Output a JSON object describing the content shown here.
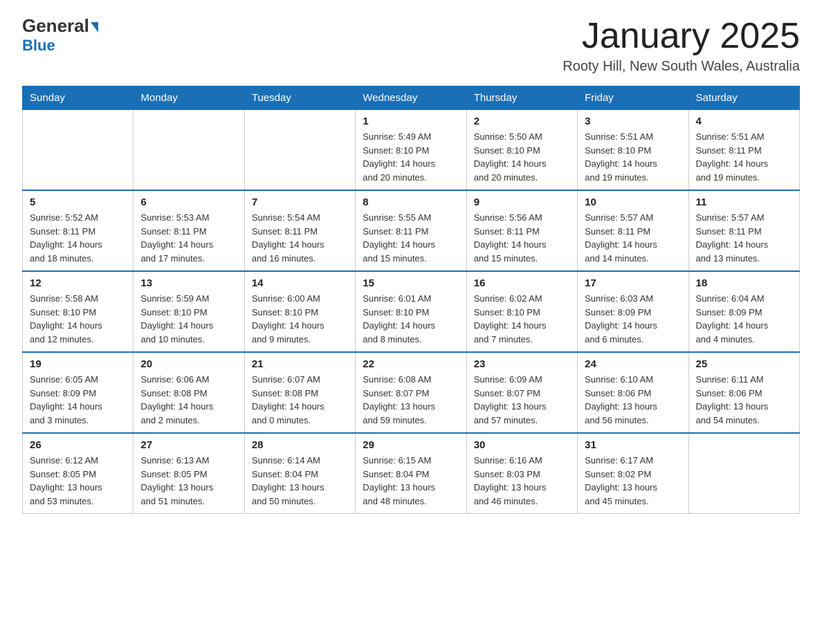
{
  "logo": {
    "general": "General",
    "arrow": "▶",
    "blue": "Blue"
  },
  "title": "January 2025",
  "subtitle": "Rooty Hill, New South Wales, Australia",
  "days_header": [
    "Sunday",
    "Monday",
    "Tuesday",
    "Wednesday",
    "Thursday",
    "Friday",
    "Saturday"
  ],
  "weeks": [
    [
      {
        "num": "",
        "info": ""
      },
      {
        "num": "",
        "info": ""
      },
      {
        "num": "",
        "info": ""
      },
      {
        "num": "1",
        "info": "Sunrise: 5:49 AM\nSunset: 8:10 PM\nDaylight: 14 hours\nand 20 minutes."
      },
      {
        "num": "2",
        "info": "Sunrise: 5:50 AM\nSunset: 8:10 PM\nDaylight: 14 hours\nand 20 minutes."
      },
      {
        "num": "3",
        "info": "Sunrise: 5:51 AM\nSunset: 8:10 PM\nDaylight: 14 hours\nand 19 minutes."
      },
      {
        "num": "4",
        "info": "Sunrise: 5:51 AM\nSunset: 8:11 PM\nDaylight: 14 hours\nand 19 minutes."
      }
    ],
    [
      {
        "num": "5",
        "info": "Sunrise: 5:52 AM\nSunset: 8:11 PM\nDaylight: 14 hours\nand 18 minutes."
      },
      {
        "num": "6",
        "info": "Sunrise: 5:53 AM\nSunset: 8:11 PM\nDaylight: 14 hours\nand 17 minutes."
      },
      {
        "num": "7",
        "info": "Sunrise: 5:54 AM\nSunset: 8:11 PM\nDaylight: 14 hours\nand 16 minutes."
      },
      {
        "num": "8",
        "info": "Sunrise: 5:55 AM\nSunset: 8:11 PM\nDaylight: 14 hours\nand 15 minutes."
      },
      {
        "num": "9",
        "info": "Sunrise: 5:56 AM\nSunset: 8:11 PM\nDaylight: 14 hours\nand 15 minutes."
      },
      {
        "num": "10",
        "info": "Sunrise: 5:57 AM\nSunset: 8:11 PM\nDaylight: 14 hours\nand 14 minutes."
      },
      {
        "num": "11",
        "info": "Sunrise: 5:57 AM\nSunset: 8:11 PM\nDaylight: 14 hours\nand 13 minutes."
      }
    ],
    [
      {
        "num": "12",
        "info": "Sunrise: 5:58 AM\nSunset: 8:10 PM\nDaylight: 14 hours\nand 12 minutes."
      },
      {
        "num": "13",
        "info": "Sunrise: 5:59 AM\nSunset: 8:10 PM\nDaylight: 14 hours\nand 10 minutes."
      },
      {
        "num": "14",
        "info": "Sunrise: 6:00 AM\nSunset: 8:10 PM\nDaylight: 14 hours\nand 9 minutes."
      },
      {
        "num": "15",
        "info": "Sunrise: 6:01 AM\nSunset: 8:10 PM\nDaylight: 14 hours\nand 8 minutes."
      },
      {
        "num": "16",
        "info": "Sunrise: 6:02 AM\nSunset: 8:10 PM\nDaylight: 14 hours\nand 7 minutes."
      },
      {
        "num": "17",
        "info": "Sunrise: 6:03 AM\nSunset: 8:09 PM\nDaylight: 14 hours\nand 6 minutes."
      },
      {
        "num": "18",
        "info": "Sunrise: 6:04 AM\nSunset: 8:09 PM\nDaylight: 14 hours\nand 4 minutes."
      }
    ],
    [
      {
        "num": "19",
        "info": "Sunrise: 6:05 AM\nSunset: 8:09 PM\nDaylight: 14 hours\nand 3 minutes."
      },
      {
        "num": "20",
        "info": "Sunrise: 6:06 AM\nSunset: 8:08 PM\nDaylight: 14 hours\nand 2 minutes."
      },
      {
        "num": "21",
        "info": "Sunrise: 6:07 AM\nSunset: 8:08 PM\nDaylight: 14 hours\nand 0 minutes."
      },
      {
        "num": "22",
        "info": "Sunrise: 6:08 AM\nSunset: 8:07 PM\nDaylight: 13 hours\nand 59 minutes."
      },
      {
        "num": "23",
        "info": "Sunrise: 6:09 AM\nSunset: 8:07 PM\nDaylight: 13 hours\nand 57 minutes."
      },
      {
        "num": "24",
        "info": "Sunrise: 6:10 AM\nSunset: 8:06 PM\nDaylight: 13 hours\nand 56 minutes."
      },
      {
        "num": "25",
        "info": "Sunrise: 6:11 AM\nSunset: 8:06 PM\nDaylight: 13 hours\nand 54 minutes."
      }
    ],
    [
      {
        "num": "26",
        "info": "Sunrise: 6:12 AM\nSunset: 8:05 PM\nDaylight: 13 hours\nand 53 minutes."
      },
      {
        "num": "27",
        "info": "Sunrise: 6:13 AM\nSunset: 8:05 PM\nDaylight: 13 hours\nand 51 minutes."
      },
      {
        "num": "28",
        "info": "Sunrise: 6:14 AM\nSunset: 8:04 PM\nDaylight: 13 hours\nand 50 minutes."
      },
      {
        "num": "29",
        "info": "Sunrise: 6:15 AM\nSunset: 8:04 PM\nDaylight: 13 hours\nand 48 minutes."
      },
      {
        "num": "30",
        "info": "Sunrise: 6:16 AM\nSunset: 8:03 PM\nDaylight: 13 hours\nand 46 minutes."
      },
      {
        "num": "31",
        "info": "Sunrise: 6:17 AM\nSunset: 8:02 PM\nDaylight: 13 hours\nand 45 minutes."
      },
      {
        "num": "",
        "info": ""
      }
    ]
  ]
}
